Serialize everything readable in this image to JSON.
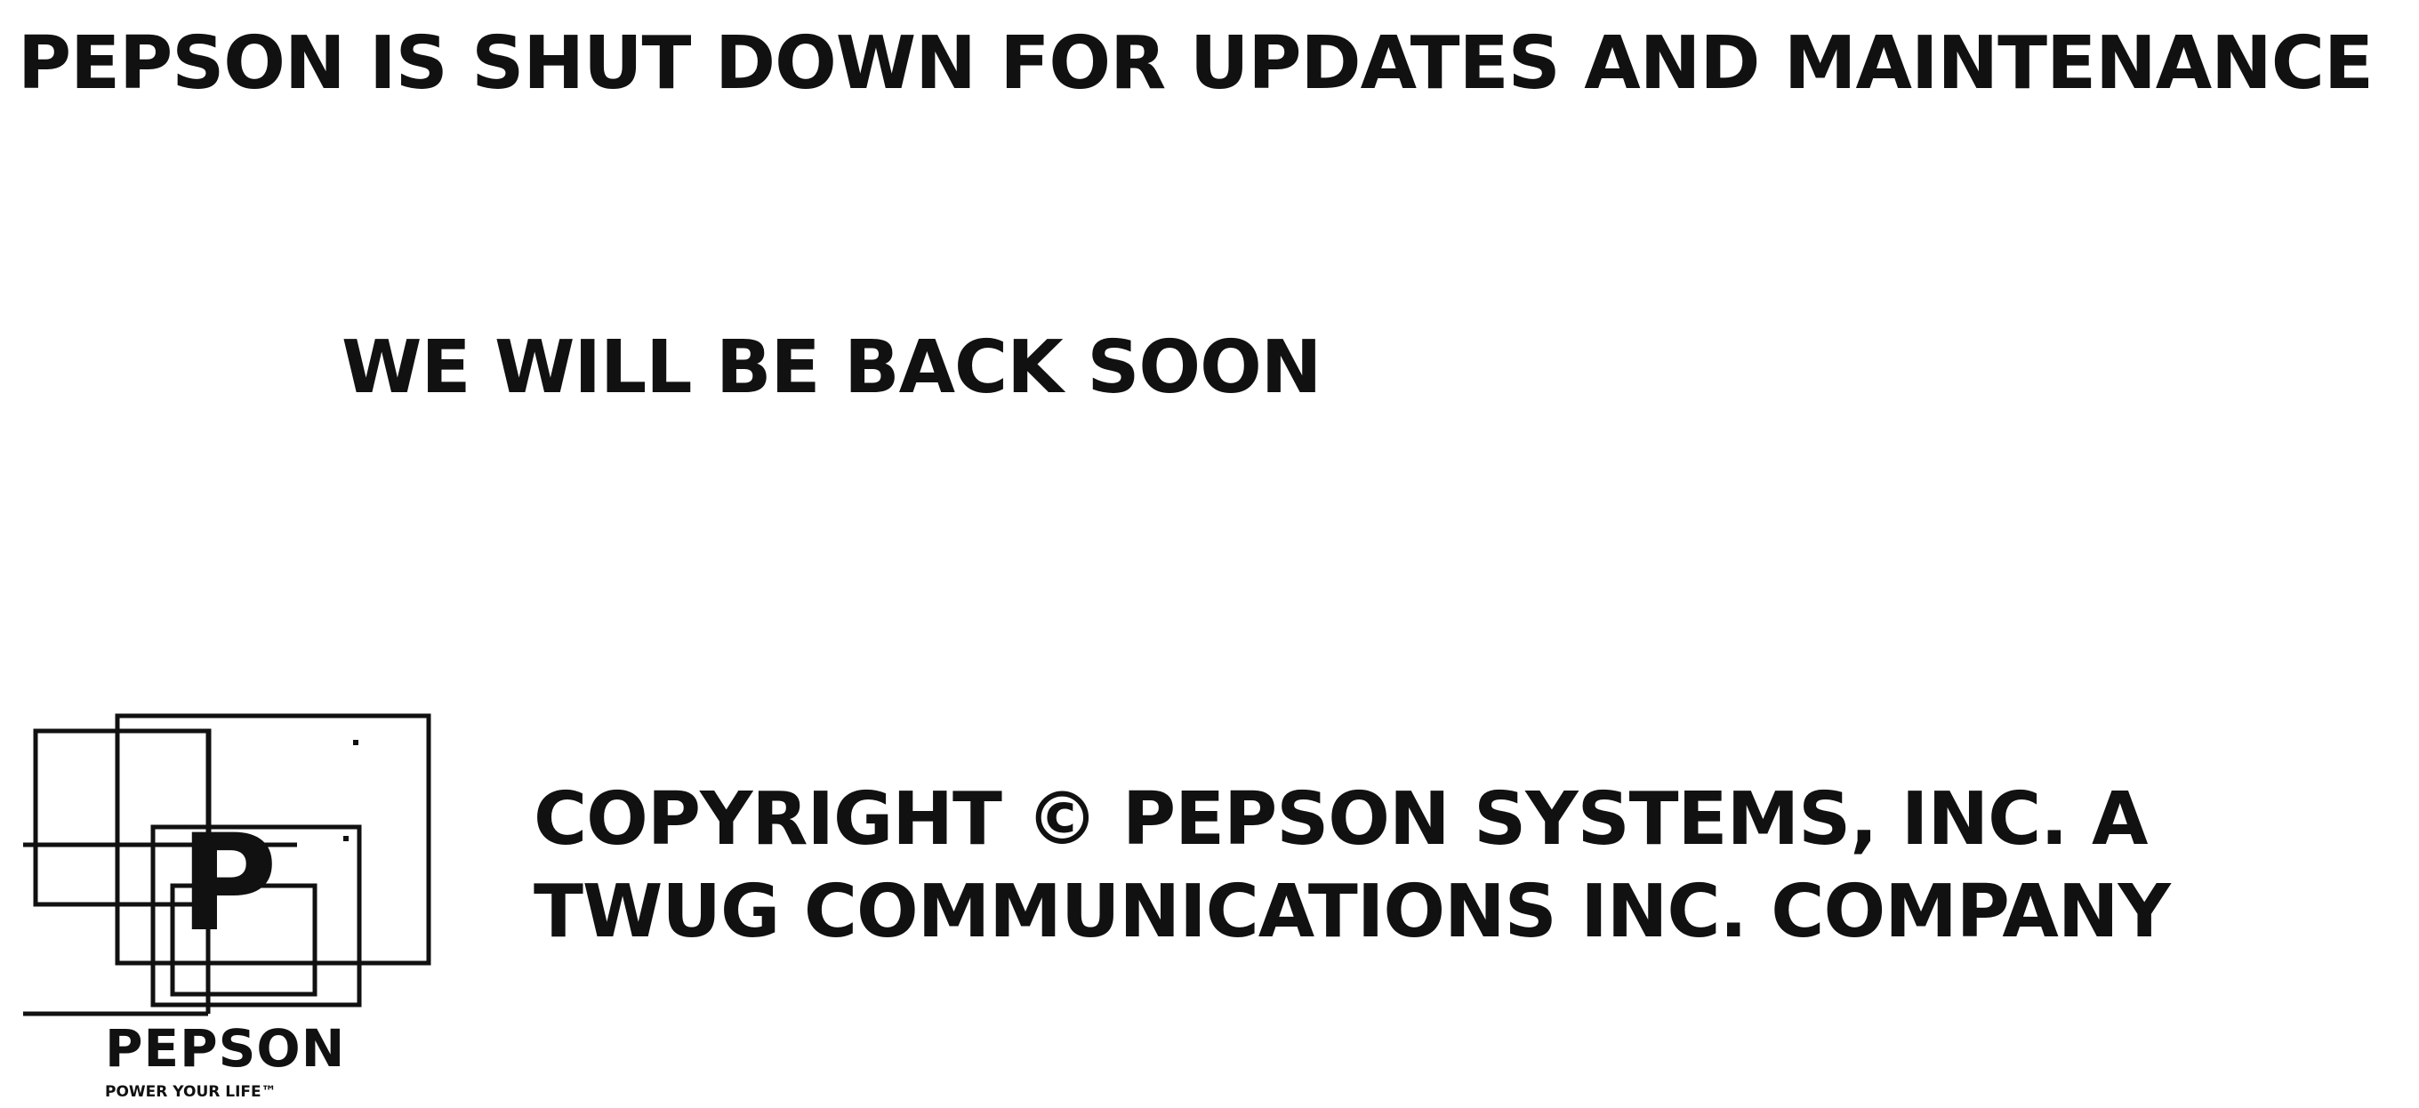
{
  "header": {
    "title": "PEPSON IS SHUT DOWN FOR UPDATES AND MAINTENANCE"
  },
  "main": {
    "message": "WE WILL BE BACK SOON"
  },
  "logo": {
    "name": "PEPSON",
    "tagline": "POWER YOUR LIFE™",
    "letter": "P"
  },
  "footer": {
    "copyright": "COPYRIGHT © PEPSON SYSTEMS, INC. A TWUG COMMUNICATIONS INC. COMPANY"
  },
  "colors": {
    "text": "#111111",
    "background": "#ffffff"
  }
}
